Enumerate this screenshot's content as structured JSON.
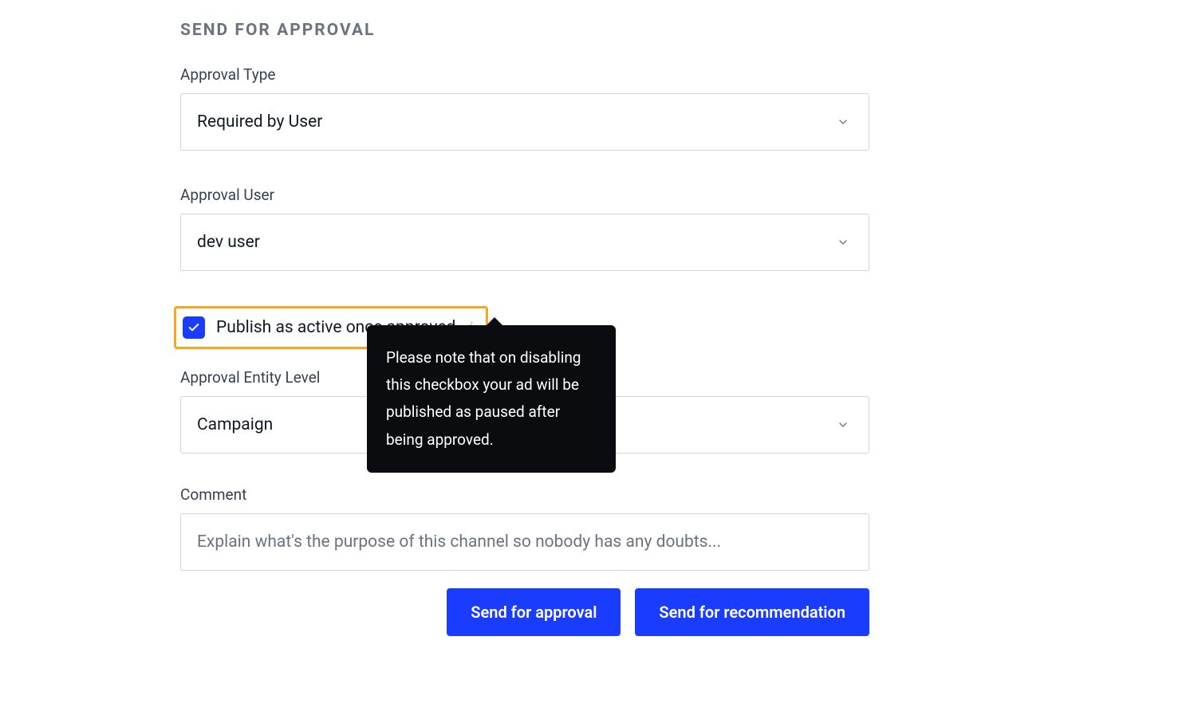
{
  "section_title": "SEND FOR APPROVAL",
  "approval_type": {
    "label": "Approval Type",
    "value": "Required by User"
  },
  "approval_user": {
    "label": "Approval User",
    "value": "dev user"
  },
  "publish_checkbox": {
    "label": "Publish as active once approved",
    "checked": true,
    "info_glyph": "i",
    "tooltip": "Please note that on disabling this checkbox your ad will be published as paused after being approved."
  },
  "approval_entity": {
    "label": "Approval Entity Level",
    "value": "Campaign"
  },
  "comment": {
    "label": "Comment",
    "placeholder": "Explain what's the purpose of this channel so nobody has any doubts..."
  },
  "buttons": {
    "approval": "Send for approval",
    "recommendation": "Send for recommendation"
  },
  "colors": {
    "primary": "#1a3cff",
    "highlight": "#f5a623"
  }
}
